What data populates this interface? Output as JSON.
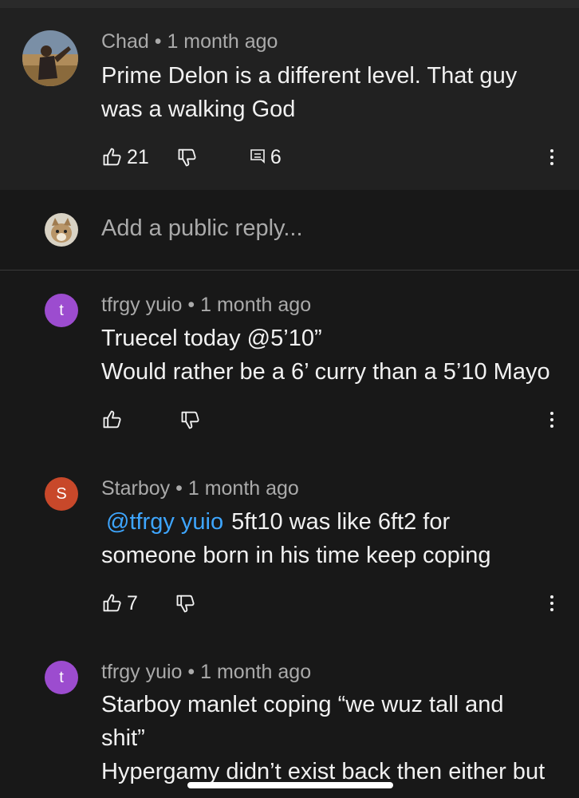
{
  "main_comment": {
    "author": "Chad",
    "separator": "•",
    "time": "1 month ago",
    "lines": [
      "Prime Delon is a different level. That guy",
      "was a walking God"
    ],
    "likes": "21",
    "replies": "6"
  },
  "reply_box": {
    "placeholder": "Add a public reply..."
  },
  "replies": [
    {
      "avatar_letter": "t",
      "avatar_color": "#9c4ccf",
      "author": "tfrgy yuio",
      "time": "1 month ago",
      "lines": [
        "Truecel today @5’10”",
        "Would rather be a 6’ curry than a 5’10 Mayo"
      ]
    },
    {
      "avatar_letter": "S",
      "avatar_color": "#c8482a",
      "author": "Starboy",
      "time": "1 month ago",
      "mention": "@tfrgy yuio",
      "lines": [
        "5ft10 was like 6ft2 for",
        "someone born in his time keep coping"
      ],
      "likes": "7"
    },
    {
      "avatar_letter": "t",
      "avatar_color": "#9c4ccf",
      "author": "tfrgy yuio",
      "time": "1 month ago",
      "lines": [
        "Starboy manlet coping “we wuz tall and",
        "shit”",
        "Hypergamy didn’t exist back then either but"
      ]
    }
  ],
  "icons": {
    "like": "thumbs-up-icon",
    "dislike": "thumbs-down-icon",
    "reply": "comment-icon",
    "more": "more-vertical-icon"
  },
  "colors": {
    "background": "#181818",
    "card": "#212121",
    "mention": "#3ea6ff",
    "secondary_text": "#aaaaaa"
  }
}
